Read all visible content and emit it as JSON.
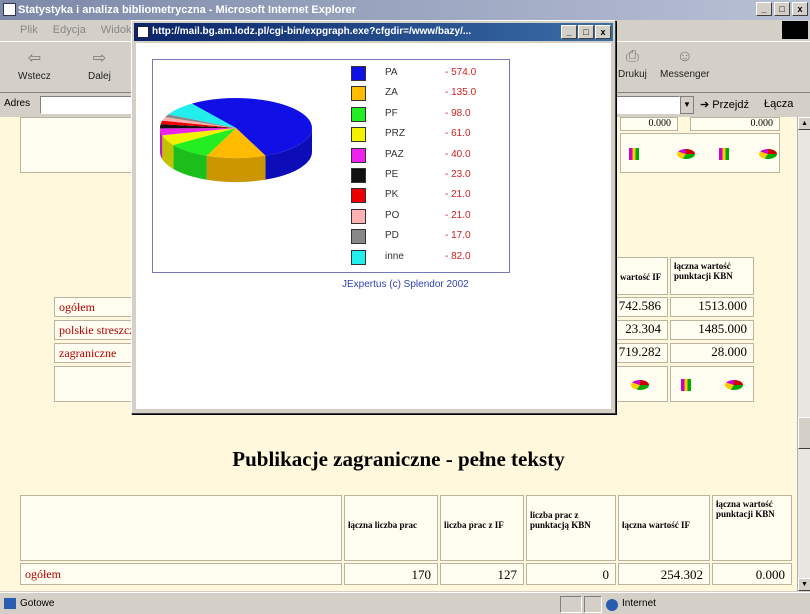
{
  "main_window": {
    "title": "Statystyka i analiza bibliometryczna - Microsoft Internet Explorer",
    "menu": [
      "Plik",
      "Edycja",
      "Widok"
    ],
    "toolbar": {
      "back": "Wstecz",
      "forward": "Dalej",
      "print": "Drukuj",
      "messenger": "Messenger"
    },
    "address_label": "Adres",
    "go_label": "Przejdź",
    "links_label": "Łącza"
  },
  "popup": {
    "title": "http://mail.bg.am.lodz.pl/cgi-bin/expgraph.exe?cfgdir=/www/bazy/...",
    "credit": "JExpertus  (c) Splendor 2002"
  },
  "chart_data": {
    "type": "pie",
    "style": "3d",
    "legend_position": "right",
    "series": [
      {
        "label": "PA",
        "value": 574.0,
        "display": "- 574.0",
        "color": "#1010e6"
      },
      {
        "label": "ZA",
        "value": 135.0,
        "display": "- 135.0",
        "color": "#ffbb00"
      },
      {
        "label": "PF",
        "value": 98.0,
        "display": "- 98.0",
        "color": "#22ee22"
      },
      {
        "label": "PRZ",
        "value": 61.0,
        "display": "- 61.0",
        "color": "#f2f200"
      },
      {
        "label": "PAZ",
        "value": 40.0,
        "display": "- 40.0",
        "color": "#ee22ee"
      },
      {
        "label": "PE",
        "value": 23.0,
        "display": "- 23.0",
        "color": "#111111"
      },
      {
        "label": "PK",
        "value": 21.0,
        "display": "- 21.0",
        "color": "#ee0000"
      },
      {
        "label": "PO",
        "value": 21.0,
        "display": "- 21.0",
        "color": "#ffb0b0"
      },
      {
        "label": "PD",
        "value": 17.0,
        "display": "- 17.0",
        "color": "#888888"
      },
      {
        "label": "inne",
        "value": 82.0,
        "display": "- 82.0",
        "color": "#22eeee"
      }
    ]
  },
  "page": {
    "top_row_values": [
      "0.000",
      "0.000"
    ],
    "table1": {
      "headers": [
        "wartość IF",
        "łączna wartość punktacji KBN"
      ],
      "rows": [
        {
          "label": "ogółem",
          "if": "742.586",
          "kbn": "1513.000"
        },
        {
          "label": "polskie streszczenia",
          "if": "23.304",
          "kbn": "1485.000"
        },
        {
          "label": "zagraniczne",
          "if": "719.282",
          "kbn": "28.000"
        }
      ]
    },
    "section_title": "Publikacje zagraniczne - pełne teksty",
    "table2": {
      "headers": [
        "łączna liczba prac",
        "liczba prac z IF",
        "liczba prac z punktacją KBN",
        "łączna wartość IF",
        "łączna wartość punktacji KBN"
      ],
      "rows": [
        {
          "label": "ogółem",
          "values": [
            "170",
            "127",
            "0",
            "254.302",
            "0.000"
          ]
        }
      ]
    }
  },
  "status": {
    "text": "Gotowe",
    "zone": "Internet"
  }
}
